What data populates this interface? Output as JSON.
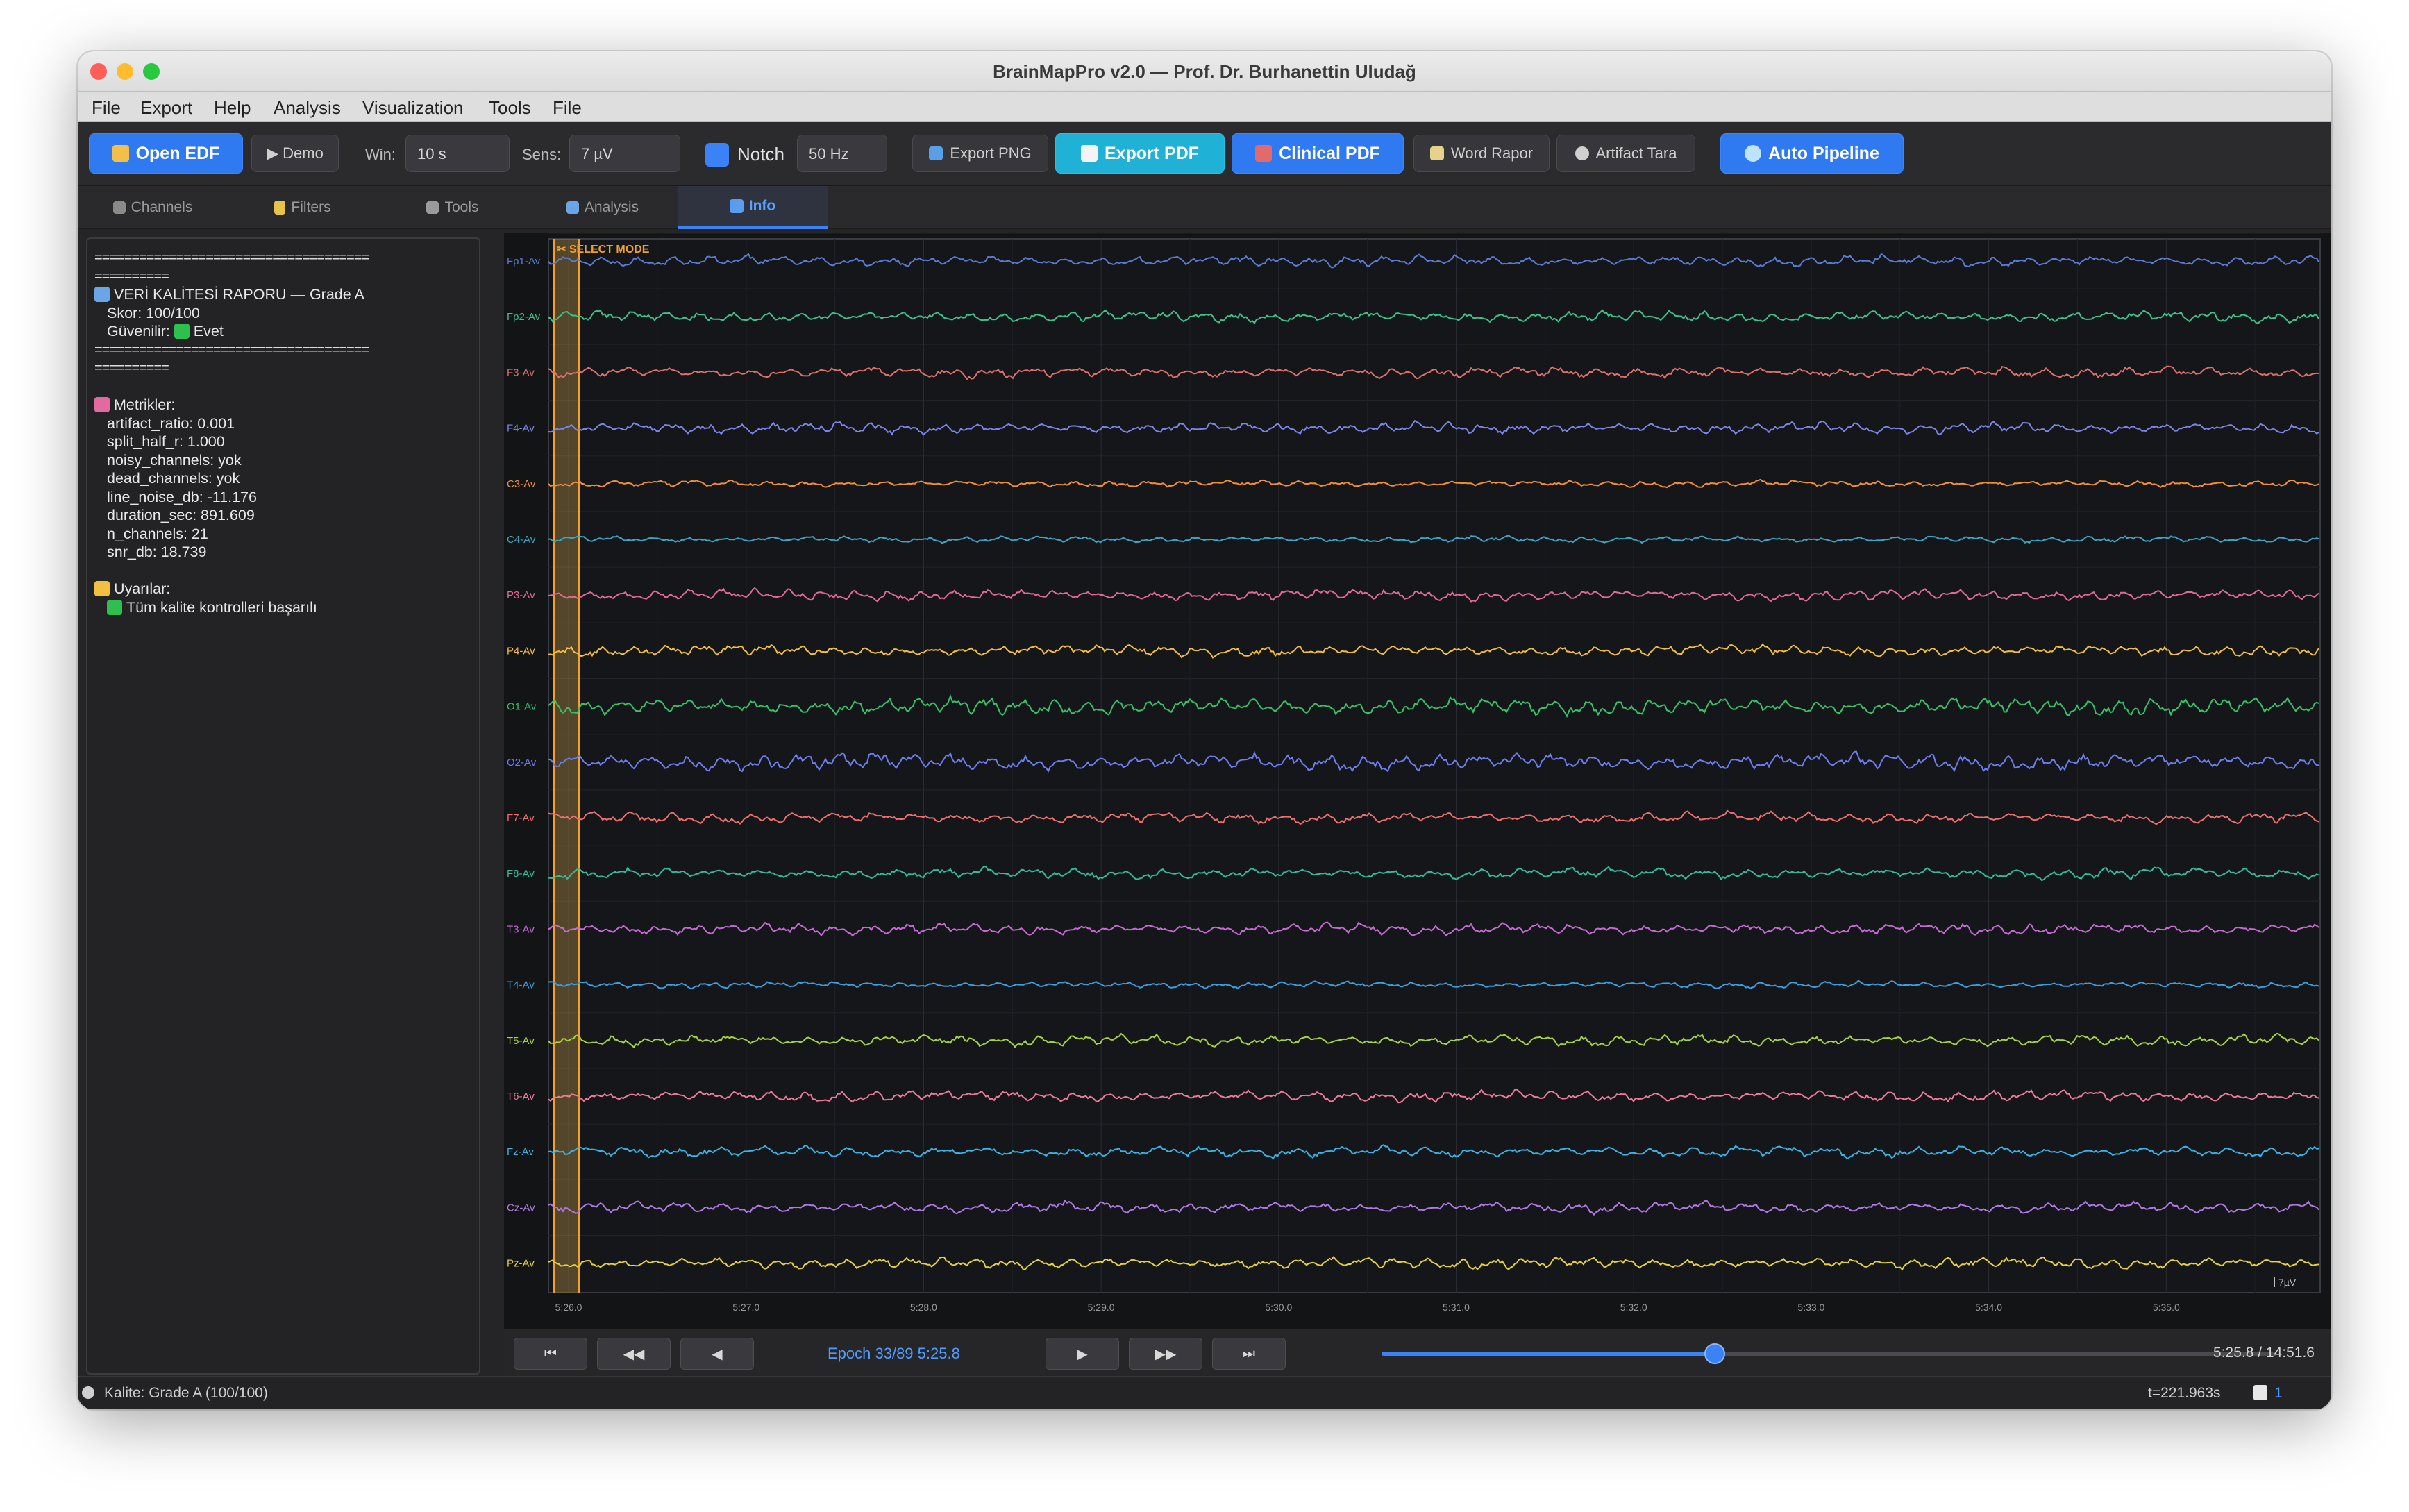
{
  "window": {
    "title": "BrainMapPro v2.0 — Prof. Dr. Burhanettin Uludağ"
  },
  "menu": [
    "File",
    "Export",
    "Help",
    "Analysis",
    "Visualization",
    "Tools",
    "File"
  ],
  "toolbar": {
    "open_edf": "Open EDF",
    "demo": "▶ Demo",
    "win_label": "Win:",
    "win_value": "10 s",
    "sens_label": "Sens:",
    "sens_value": "7 µV",
    "notch_label": "Notch",
    "notch_value": "50 Hz",
    "export_png": "Export PNG",
    "export_pdf": "Export PDF",
    "clinical_pdf": "Clinical PDF",
    "word_rapor": "Word Rapor",
    "artifact_tara": "Artifact Tara",
    "auto_pipeline": "Auto Pipeline"
  },
  "tabs": [
    {
      "label": "Channels",
      "icon": "plug-icon"
    },
    {
      "label": "Filters",
      "icon": "lightning-icon"
    },
    {
      "label": "Tools",
      "icon": "wrench-icon"
    },
    {
      "label": "Analysis",
      "icon": "bar-chart-icon"
    },
    {
      "label": "Info",
      "icon": "info-icon",
      "active": true
    }
  ],
  "info_panel": {
    "separator": "=====================================",
    "separator_tail": "==========",
    "title": "VERİ KALİTESİ RAPORU — Grade A",
    "score": "Skor: 100/100",
    "reliable_label": "Güvenilir:",
    "reliable_value": "Evet",
    "metrics_header": "Metrikler:",
    "metrics": [
      "artifact_ratio: 0.001",
      "split_half_r: 1.000",
      "noisy_channels: yok",
      "dead_channels: yok",
      "line_noise_db: -11.176",
      "duration_sec: 891.609",
      "n_channels: 21",
      "snr_db: 18.739"
    ],
    "warnings_header": "Uyarılar:",
    "warnings": [
      "Tüm kalite kontrolleri başarılı"
    ]
  },
  "eeg": {
    "select_mode": "✂ SELECT MODE",
    "scale_label": "7µV",
    "channels": [
      {
        "name": "Fp1-Av",
        "color": "#5b7bd6"
      },
      {
        "name": "Fp2-Av",
        "color": "#3cc48a"
      },
      {
        "name": "F3-Av",
        "color": "#e0706e"
      },
      {
        "name": "F4-Av",
        "color": "#7a86e8"
      },
      {
        "name": "C3-Av",
        "color": "#f0913a"
      },
      {
        "name": "C4-Av",
        "color": "#3aa8c6"
      },
      {
        "name": "P3-Av",
        "color": "#e26a95"
      },
      {
        "name": "P4-Av",
        "color": "#f2c040"
      },
      {
        "name": "O1-Av",
        "color": "#34c46a"
      },
      {
        "name": "O2-Av",
        "color": "#6c7ef0"
      },
      {
        "name": "F7-Av",
        "color": "#ef6f6f"
      },
      {
        "name": "F8-Av",
        "color": "#2fbf9c"
      },
      {
        "name": "T3-Av",
        "color": "#c86bd6"
      },
      {
        "name": "T4-Av",
        "color": "#3aa0e0"
      },
      {
        "name": "T5-Av",
        "color": "#a6d63a"
      },
      {
        "name": "T6-Av",
        "color": "#f07a9a"
      },
      {
        "name": "Fz-Av",
        "color": "#3ab4e6"
      },
      {
        "name": "Cz-Av",
        "color": "#b07ae6"
      },
      {
        "name": "Pz-Av",
        "color": "#e6d23a"
      }
    ],
    "time_ticks": [
      "5:26.0",
      "5:27.0",
      "5:28.0",
      "5:29.0",
      "5:30.0",
      "5:31.0",
      "5:32.0",
      "5:33.0",
      "5:34.0",
      "5:35.0"
    ]
  },
  "nav": {
    "first": "⏮",
    "prev_fast": "◀◀",
    "prev": "◀",
    "epoch": "Epoch 33/89  5:25.8",
    "next": "▶",
    "next_fast": "▶▶",
    "last": "⏭",
    "slider_fraction": 0.372,
    "time": "5:25.8 / 14:51.6"
  },
  "status": {
    "quality": "Kalite: Grade A (100/100)",
    "t": "t=221.963s",
    "count": "1"
  }
}
